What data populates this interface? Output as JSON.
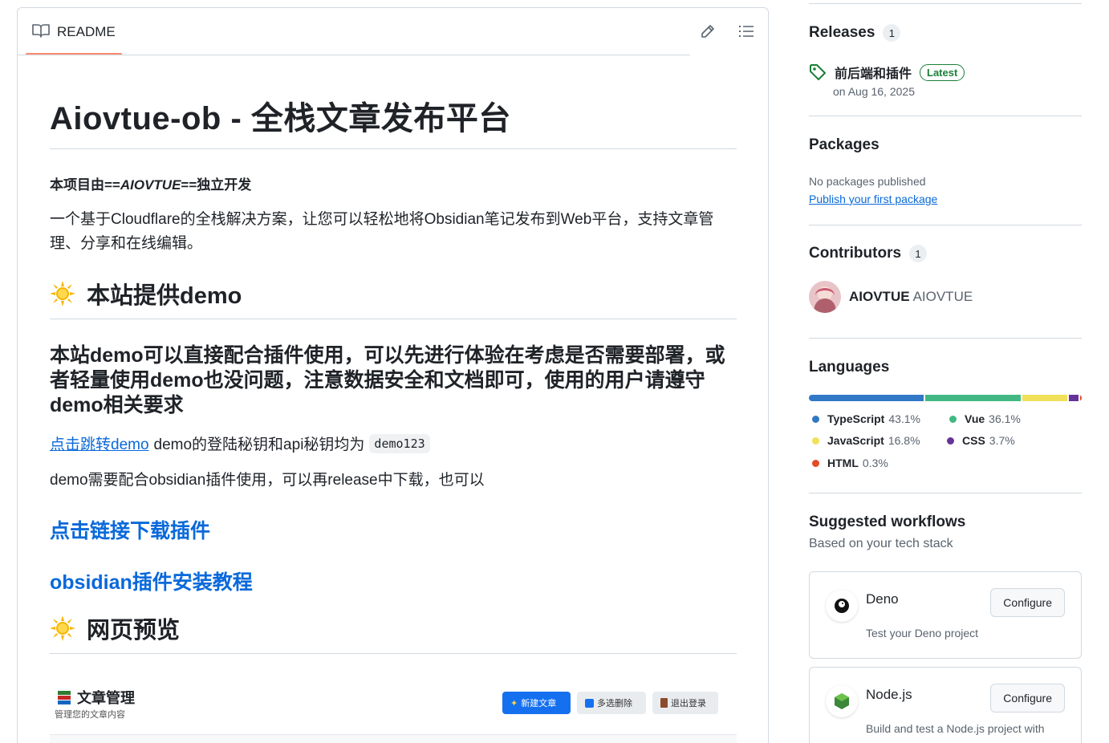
{
  "readme": {
    "tab_label": "README",
    "title": "Aiovtue-ob - 全栈文章发布平台",
    "author_prefix": "本项目由==",
    "author_name": "AIOVTUE",
    "author_suffix": "==独立开发",
    "intro": "一个基于Cloudflare的全栈解决方案，让您可以轻松地将Obsidian笔记发布到Web平台，支持文章管理、分享和在线编辑。",
    "section_demo": "本站提供demo",
    "demo_note": "本站demo可以直接配合插件使用，可以先进行体验在考虑是否需要部署，或者轻量使用demo也没问题，注意数据安全和文档即可，使用的用户请遵守demo相关要求",
    "demo_link": "点击跳转demo",
    "demo_key_text": "demo的登陆秘钥和api秘钥均为",
    "demo_key": "demo123",
    "plugin_note": "demo需要配合obsidian插件使用，可以再release中下载，也可以",
    "download_link": "点击链接下载插件",
    "tutorial_link": "obsidian插件安装教程",
    "section_preview": "网页预览"
  },
  "preview": {
    "title": "文章管理",
    "subtitle": "管理您的文章内容",
    "btn_new": "新建文章",
    "btn_multi": "多选删除",
    "btn_logout": "退出登录"
  },
  "sidebar": {
    "releases": {
      "title": "Releases",
      "count": "1",
      "latest_name": "前后端和插件",
      "latest_badge": "Latest",
      "date": "on Aug 16, 2025"
    },
    "packages": {
      "title": "Packages",
      "empty": "No packages published",
      "link": "Publish your first package"
    },
    "contributors": {
      "title": "Contributors",
      "count": "1",
      "login": "AIOVTUE",
      "name": "AIOVTUE"
    },
    "languages": {
      "title": "Languages",
      "items": [
        {
          "name": "TypeScript",
          "pct": "43.1%",
          "color": "#3178c6",
          "value": 43.1
        },
        {
          "name": "Vue",
          "pct": "36.1%",
          "color": "#41b883",
          "value": 36.1
        },
        {
          "name": "JavaScript",
          "pct": "16.8%",
          "color": "#f1e05a",
          "value": 16.8
        },
        {
          "name": "CSS",
          "pct": "3.7%",
          "color": "#663399",
          "value": 3.7
        },
        {
          "name": "HTML",
          "pct": "0.3%",
          "color": "#e34c26",
          "value": 0.3
        }
      ]
    },
    "workflows": {
      "title": "Suggested workflows",
      "subtitle": "Based on your tech stack",
      "items": [
        {
          "name": "Deno",
          "desc": "Test your Deno project",
          "button": "Configure"
        },
        {
          "name": "Node.js",
          "desc": "Build and test a Node.js project with",
          "button": "Configure"
        }
      ]
    }
  }
}
